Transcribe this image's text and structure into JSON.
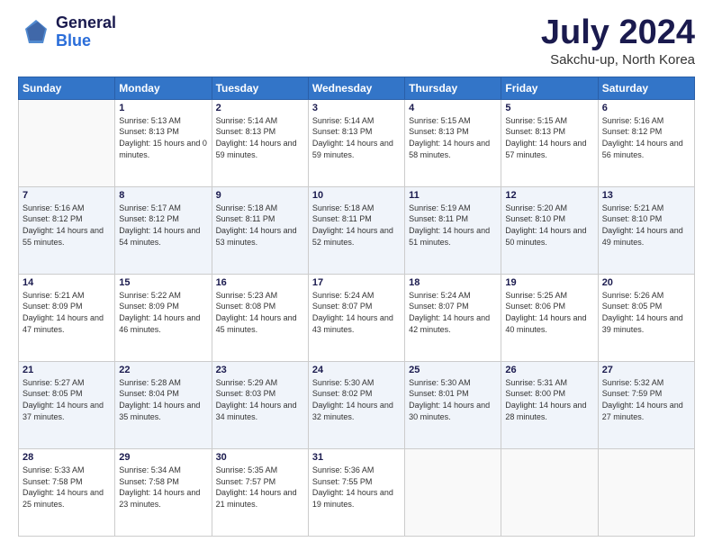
{
  "header": {
    "logo_general": "General",
    "logo_blue": "Blue",
    "month": "July 2024",
    "location": "Sakchu-up, North Korea"
  },
  "weekdays": [
    "Sunday",
    "Monday",
    "Tuesday",
    "Wednesday",
    "Thursday",
    "Friday",
    "Saturday"
  ],
  "weeks": [
    [
      {
        "day": "",
        "info": ""
      },
      {
        "day": "1",
        "info": "Sunrise: 5:13 AM\nSunset: 8:13 PM\nDaylight: 15 hours\nand 0 minutes."
      },
      {
        "day": "2",
        "info": "Sunrise: 5:14 AM\nSunset: 8:13 PM\nDaylight: 14 hours\nand 59 minutes."
      },
      {
        "day": "3",
        "info": "Sunrise: 5:14 AM\nSunset: 8:13 PM\nDaylight: 14 hours\nand 59 minutes."
      },
      {
        "day": "4",
        "info": "Sunrise: 5:15 AM\nSunset: 8:13 PM\nDaylight: 14 hours\nand 58 minutes."
      },
      {
        "day": "5",
        "info": "Sunrise: 5:15 AM\nSunset: 8:13 PM\nDaylight: 14 hours\nand 57 minutes."
      },
      {
        "day": "6",
        "info": "Sunrise: 5:16 AM\nSunset: 8:12 PM\nDaylight: 14 hours\nand 56 minutes."
      }
    ],
    [
      {
        "day": "7",
        "info": "Sunrise: 5:16 AM\nSunset: 8:12 PM\nDaylight: 14 hours\nand 55 minutes."
      },
      {
        "day": "8",
        "info": "Sunrise: 5:17 AM\nSunset: 8:12 PM\nDaylight: 14 hours\nand 54 minutes."
      },
      {
        "day": "9",
        "info": "Sunrise: 5:18 AM\nSunset: 8:11 PM\nDaylight: 14 hours\nand 53 minutes."
      },
      {
        "day": "10",
        "info": "Sunrise: 5:18 AM\nSunset: 8:11 PM\nDaylight: 14 hours\nand 52 minutes."
      },
      {
        "day": "11",
        "info": "Sunrise: 5:19 AM\nSunset: 8:11 PM\nDaylight: 14 hours\nand 51 minutes."
      },
      {
        "day": "12",
        "info": "Sunrise: 5:20 AM\nSunset: 8:10 PM\nDaylight: 14 hours\nand 50 minutes."
      },
      {
        "day": "13",
        "info": "Sunrise: 5:21 AM\nSunset: 8:10 PM\nDaylight: 14 hours\nand 49 minutes."
      }
    ],
    [
      {
        "day": "14",
        "info": "Sunrise: 5:21 AM\nSunset: 8:09 PM\nDaylight: 14 hours\nand 47 minutes."
      },
      {
        "day": "15",
        "info": "Sunrise: 5:22 AM\nSunset: 8:09 PM\nDaylight: 14 hours\nand 46 minutes."
      },
      {
        "day": "16",
        "info": "Sunrise: 5:23 AM\nSunset: 8:08 PM\nDaylight: 14 hours\nand 45 minutes."
      },
      {
        "day": "17",
        "info": "Sunrise: 5:24 AM\nSunset: 8:07 PM\nDaylight: 14 hours\nand 43 minutes."
      },
      {
        "day": "18",
        "info": "Sunrise: 5:24 AM\nSunset: 8:07 PM\nDaylight: 14 hours\nand 42 minutes."
      },
      {
        "day": "19",
        "info": "Sunrise: 5:25 AM\nSunset: 8:06 PM\nDaylight: 14 hours\nand 40 minutes."
      },
      {
        "day": "20",
        "info": "Sunrise: 5:26 AM\nSunset: 8:05 PM\nDaylight: 14 hours\nand 39 minutes."
      }
    ],
    [
      {
        "day": "21",
        "info": "Sunrise: 5:27 AM\nSunset: 8:05 PM\nDaylight: 14 hours\nand 37 minutes."
      },
      {
        "day": "22",
        "info": "Sunrise: 5:28 AM\nSunset: 8:04 PM\nDaylight: 14 hours\nand 35 minutes."
      },
      {
        "day": "23",
        "info": "Sunrise: 5:29 AM\nSunset: 8:03 PM\nDaylight: 14 hours\nand 34 minutes."
      },
      {
        "day": "24",
        "info": "Sunrise: 5:30 AM\nSunset: 8:02 PM\nDaylight: 14 hours\nand 32 minutes."
      },
      {
        "day": "25",
        "info": "Sunrise: 5:30 AM\nSunset: 8:01 PM\nDaylight: 14 hours\nand 30 minutes."
      },
      {
        "day": "26",
        "info": "Sunrise: 5:31 AM\nSunset: 8:00 PM\nDaylight: 14 hours\nand 28 minutes."
      },
      {
        "day": "27",
        "info": "Sunrise: 5:32 AM\nSunset: 7:59 PM\nDaylight: 14 hours\nand 27 minutes."
      }
    ],
    [
      {
        "day": "28",
        "info": "Sunrise: 5:33 AM\nSunset: 7:58 PM\nDaylight: 14 hours\nand 25 minutes."
      },
      {
        "day": "29",
        "info": "Sunrise: 5:34 AM\nSunset: 7:58 PM\nDaylight: 14 hours\nand 23 minutes."
      },
      {
        "day": "30",
        "info": "Sunrise: 5:35 AM\nSunset: 7:57 PM\nDaylight: 14 hours\nand 21 minutes."
      },
      {
        "day": "31",
        "info": "Sunrise: 5:36 AM\nSunset: 7:55 PM\nDaylight: 14 hours\nand 19 minutes."
      },
      {
        "day": "",
        "info": ""
      },
      {
        "day": "",
        "info": ""
      },
      {
        "day": "",
        "info": ""
      }
    ]
  ]
}
